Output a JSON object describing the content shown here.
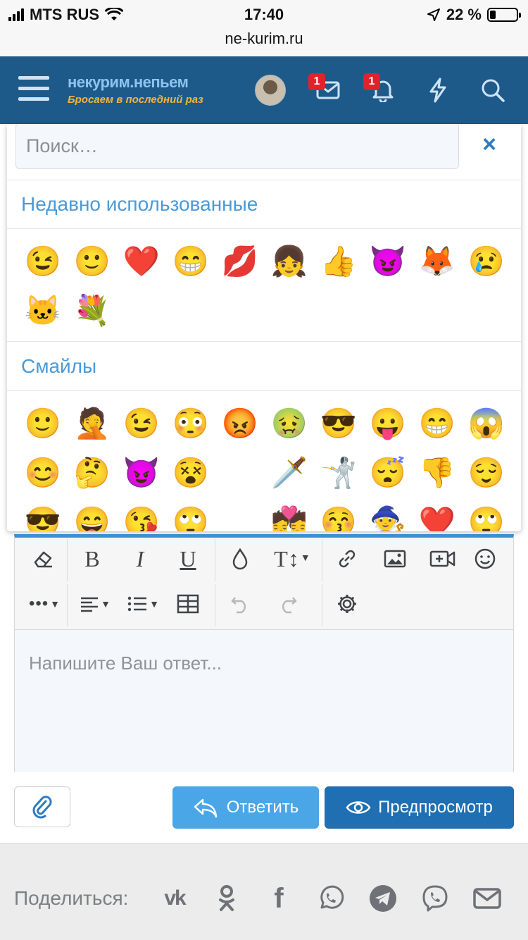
{
  "status_bar": {
    "carrier": "MTS RUS",
    "time": "17:40",
    "battery": "22 %",
    "url": "ne-kurim.ru"
  },
  "header": {
    "logo_line1": "некурим.непьем",
    "logo_line2": "Бросаем в последний раз",
    "messages_badge": "1",
    "alerts_badge": "1",
    "icons": [
      "menu-icon",
      "avatar",
      "envelope-icon",
      "bell-icon",
      "bolt-icon",
      "search-icon"
    ]
  },
  "emoji_picker": {
    "search_placeholder": "Поиск…",
    "close_label": "×",
    "recent_title": "Недавно использованные",
    "recent": [
      "😉",
      "🙂",
      "❤️",
      "😁",
      "💋",
      "👧",
      "👍",
      "😈",
      "🦊",
      "😢",
      "🐱",
      "💐"
    ],
    "smileys_title": "Смайлы",
    "smileys": [
      "🙂",
      "🤦",
      "😉",
      "😳",
      "😡",
      "🤢",
      "😎",
      "😛",
      "😁",
      "😱",
      "😊",
      "🤔",
      "😈",
      "😵",
      "",
      "🗡️",
      "🤺",
      "😴",
      "👎",
      "😌",
      "😎",
      "😄",
      "😘",
      "🙄",
      "",
      "💏",
      "😚",
      "🧙",
      "❤️",
      "🙄"
    ]
  },
  "editor": {
    "toolbar_row1": [
      "eraser-icon",
      "bold",
      "italic",
      "underline",
      "color-drop-icon",
      "text-size-icon",
      "link-icon",
      "image-icon",
      "video-icon",
      "smiley-icon"
    ],
    "toolbar_row2": [
      "more-icon",
      "align-icon",
      "list-icon",
      "table-icon",
      "undo-icon",
      "redo-icon",
      "settings-icon"
    ],
    "bold": "B",
    "italic": "I",
    "underline": "U",
    "text_size": "T↕",
    "placeholder": "Напишите Ваш ответ..."
  },
  "actions": {
    "reply": "Ответить",
    "preview": "Предпросмотр"
  },
  "share": {
    "label": "Поделиться:",
    "networks": [
      "vk-icon",
      "odnoklassniki-icon",
      "facebook-icon",
      "whatsapp-icon",
      "telegram-icon",
      "viber-icon",
      "email-icon"
    ],
    "vk_text": "vk",
    "fb_text": "f"
  },
  "colors": {
    "header_bg": "#1d5a8a",
    "accent": "#4a9ad8",
    "reply_btn": "#4aa6e6",
    "preview_btn": "#1f6fb2",
    "badge": "#e0222b"
  }
}
